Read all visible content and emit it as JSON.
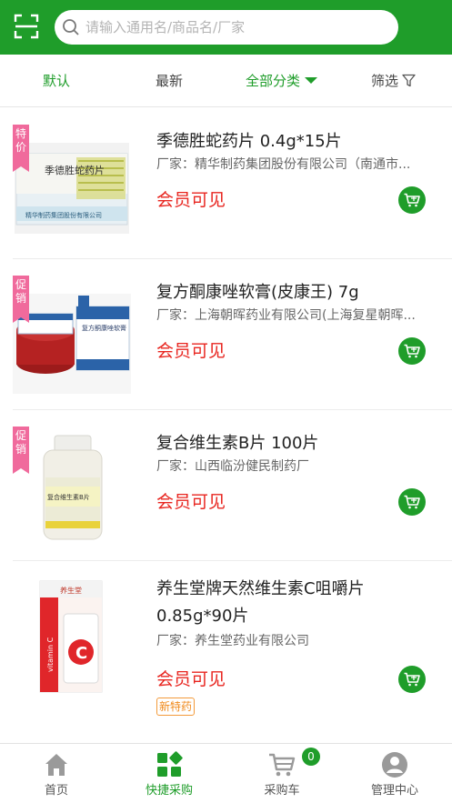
{
  "header": {
    "scan_icon": "scan-icon",
    "search_placeholder": "请输入通用名/商品名/厂家",
    "brand_color": "#1f9d2a"
  },
  "filters": {
    "default": "默认",
    "latest": "最新",
    "category": "全部分类",
    "screen": "筛选"
  },
  "products": [
    {
      "tag": "特价",
      "name": "季德胜蛇药片 0.4g*15片",
      "maker": "厂家：精华制药集团股份有限公司（南通市...",
      "price": "会员可见"
    },
    {
      "tag": "促销",
      "name": "复方酮康唑软膏(皮康王) 7g",
      "maker": "厂家：上海朝晖药业有限公司(上海复星朝晖...",
      "price": "会员可见"
    },
    {
      "tag": "促销",
      "name": "复合维生素B片 100片",
      "maker": "厂家：山西临汾健民制药厂",
      "price": "会员可见"
    },
    {
      "tag": "",
      "name": "养生堂牌天然维生素C咀嚼片 0.85g*90片",
      "maker": "厂家：养生堂药业有限公司",
      "price": "会员可见",
      "badge": "新特药"
    }
  ],
  "product_images": {
    "p1_box_title": "季德胜蛇药片",
    "p1_box_maker": "精华制药集团股份有限公司",
    "p2_box_title": "复方酮康唑软膏",
    "p3_label_title": "复合维生素B片",
    "p4_label_side": "vitamin C",
    "p4_label_brand": "养生堂",
    "p4_label_letter": "C"
  },
  "tabbar": {
    "home": "首页",
    "quick": "快捷采购",
    "cart": "采购车",
    "cart_count": "0",
    "admin": "管理中心"
  }
}
